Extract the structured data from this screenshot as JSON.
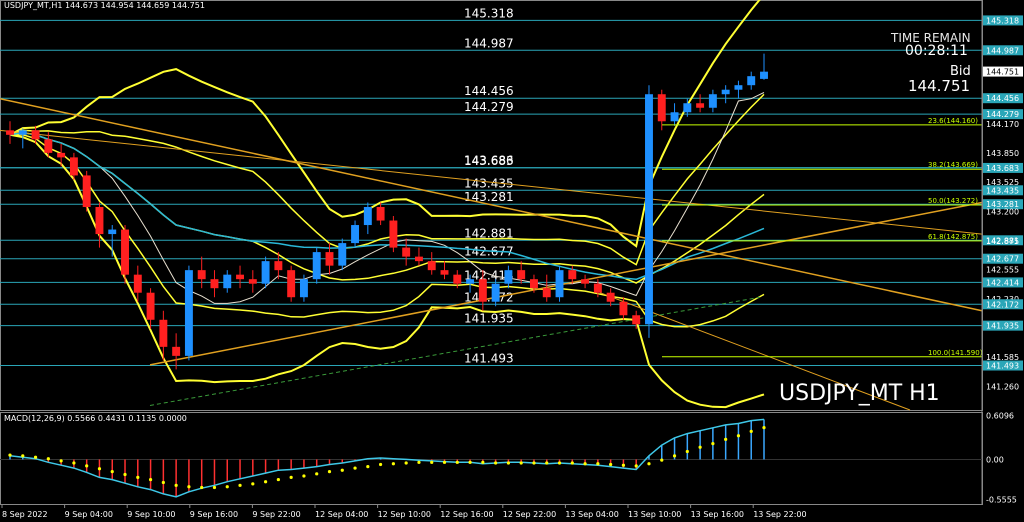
{
  "header": {
    "symbol_info": "USDJPY_MT,H1  144.673 144.954 144.659 144.751"
  },
  "time_remain": {
    "label": "TIME REMAIN",
    "value": "00:28:11"
  },
  "bid": {
    "label": "Bid",
    "value": "144.751"
  },
  "watermark": "USDJPY_MT H1",
  "macd_header": "MACD(12,26,9) 0.5566 0.4431 0.1135 0.0000",
  "colors": {
    "background": "#000000",
    "bull_candle": "#1e90ff",
    "bear_candle": "#ff2020",
    "bollinger": "#ffff33",
    "trendline": "#e0a020",
    "fib": "#c8ff00",
    "ma_cyan": "#2ab8d8",
    "level_line": "#2aa6b8",
    "macd_signal": "#ffff00"
  },
  "chart_data": [
    {
      "type": "candlestick",
      "title": "USDJPY_MT H1",
      "ylim": [
        141.0,
        145.5
      ],
      "y_axis_ticks": [
        "145.318",
        "144.987",
        "144.751",
        "144.456",
        "144.279",
        "144.170",
        "143.850",
        "143.683",
        "143.525",
        "143.435",
        "143.281",
        "143.200",
        "142.881",
        "142.875",
        "142.677",
        "142.555",
        "142.414",
        "142.230",
        "142.172",
        "141.935",
        "141.585",
        "141.493",
        "141.260"
      ],
      "x_tick_labels": [
        "8 Sep 2022",
        "9 Sep 04:00",
        "9 Sep 10:00",
        "9 Sep 16:00",
        "9 Sep 22:00",
        "12 Sep 04:00",
        "12 Sep 10:00",
        "12 Sep 16:00",
        "12 Sep 22:00",
        "13 Sep 04:00",
        "13 Sep 10:00",
        "13 Sep 16:00",
        "13 Sep 22:00"
      ],
      "horizontal_levels": [
        {
          "value": 145.318,
          "label": "145.318"
        },
        {
          "value": 144.987,
          "label": "144.987"
        },
        {
          "value": 144.456,
          "label": "144.456"
        },
        {
          "value": 144.279,
          "label": "144.279"
        },
        {
          "value": 143.686,
          "label": "143.686"
        },
        {
          "value": 143.683,
          "label": "143.683"
        },
        {
          "value": 143.435,
          "label": "143.435"
        },
        {
          "value": 143.281,
          "label": "143.281"
        },
        {
          "value": 142.881,
          "label": "142.881"
        },
        {
          "value": 142.677,
          "label": "142.677"
        },
        {
          "value": 142.414,
          "label": "142.414"
        },
        {
          "value": 142.172,
          "label": "142.172"
        },
        {
          "value": 141.935,
          "label": "141.935"
        },
        {
          "value": 141.493,
          "label": "141.493"
        }
      ],
      "fibonacci": [
        {
          "label": "23.6(144.160)",
          "value": 144.16
        },
        {
          "label": "38.2(143.669)",
          "value": 143.669
        },
        {
          "label": "50.0(143.272)",
          "value": 143.272
        },
        {
          "label": "61.8(142.875)",
          "value": 142.875
        },
        {
          "label": "100.0(141.590)",
          "value": 141.59
        }
      ],
      "candles": [
        {
          "o": 144.1,
          "h": 144.2,
          "l": 143.95,
          "c": 144.05
        },
        {
          "o": 144.05,
          "h": 144.12,
          "l": 143.9,
          "c": 144.1
        },
        {
          "o": 144.1,
          "h": 144.15,
          "l": 143.95,
          "c": 144.0
        },
        {
          "o": 144.0,
          "h": 144.08,
          "l": 143.8,
          "c": 143.85
        },
        {
          "o": 143.85,
          "h": 143.95,
          "l": 143.7,
          "c": 143.8
        },
        {
          "o": 143.8,
          "h": 143.85,
          "l": 143.55,
          "c": 143.6
        },
        {
          "o": 143.6,
          "h": 143.65,
          "l": 143.2,
          "c": 143.25
        },
        {
          "o": 143.25,
          "h": 143.3,
          "l": 142.8,
          "c": 142.95
        },
        {
          "o": 142.95,
          "h": 143.05,
          "l": 142.7,
          "c": 143.0
        },
        {
          "o": 143.0,
          "h": 143.05,
          "l": 142.4,
          "c": 142.5
        },
        {
          "o": 142.5,
          "h": 142.6,
          "l": 142.2,
          "c": 142.3
        },
        {
          "o": 142.3,
          "h": 142.35,
          "l": 141.9,
          "c": 142.0
        },
        {
          "o": 142.0,
          "h": 142.1,
          "l": 141.55,
          "c": 141.7
        },
        {
          "o": 141.7,
          "h": 141.85,
          "l": 141.45,
          "c": 141.6
        },
        {
          "o": 141.6,
          "h": 142.6,
          "l": 141.55,
          "c": 142.55
        },
        {
          "o": 142.55,
          "h": 142.7,
          "l": 142.35,
          "c": 142.45
        },
        {
          "o": 142.45,
          "h": 142.55,
          "l": 142.25,
          "c": 142.35
        },
        {
          "o": 142.35,
          "h": 142.55,
          "l": 142.3,
          "c": 142.5
        },
        {
          "o": 142.5,
          "h": 142.6,
          "l": 142.35,
          "c": 142.45
        },
        {
          "o": 142.45,
          "h": 142.55,
          "l": 142.3,
          "c": 142.4
        },
        {
          "o": 142.4,
          "h": 142.7,
          "l": 142.35,
          "c": 142.65
        },
        {
          "o": 142.65,
          "h": 142.75,
          "l": 142.45,
          "c": 142.55
        },
        {
          "o": 142.55,
          "h": 142.6,
          "l": 142.2,
          "c": 142.25
        },
        {
          "o": 142.25,
          "h": 142.5,
          "l": 142.2,
          "c": 142.45
        },
        {
          "o": 142.45,
          "h": 142.8,
          "l": 142.4,
          "c": 142.75
        },
        {
          "o": 142.75,
          "h": 142.85,
          "l": 142.5,
          "c": 142.6
        },
        {
          "o": 142.6,
          "h": 142.9,
          "l": 142.55,
          "c": 142.85
        },
        {
          "o": 142.85,
          "h": 143.1,
          "l": 142.8,
          "c": 143.05
        },
        {
          "o": 143.05,
          "h": 143.3,
          "l": 142.95,
          "c": 143.25
        },
        {
          "o": 143.25,
          "h": 143.3,
          "l": 143.05,
          "c": 143.1
        },
        {
          "o": 143.1,
          "h": 143.15,
          "l": 142.75,
          "c": 142.8
        },
        {
          "o": 142.8,
          "h": 142.9,
          "l": 142.6,
          "c": 142.7
        },
        {
          "o": 142.7,
          "h": 142.8,
          "l": 142.6,
          "c": 142.65
        },
        {
          "o": 142.65,
          "h": 142.75,
          "l": 142.5,
          "c": 142.55
        },
        {
          "o": 142.55,
          "h": 142.65,
          "l": 142.45,
          "c": 142.5
        },
        {
          "o": 142.5,
          "h": 142.55,
          "l": 142.35,
          "c": 142.4
        },
        {
          "o": 142.4,
          "h": 142.5,
          "l": 142.3,
          "c": 142.45
        },
        {
          "o": 142.45,
          "h": 142.55,
          "l": 142.1,
          "c": 142.2
        },
        {
          "o": 142.2,
          "h": 142.45,
          "l": 142.15,
          "c": 142.4
        },
        {
          "o": 142.4,
          "h": 142.6,
          "l": 142.35,
          "c": 142.55
        },
        {
          "o": 142.55,
          "h": 142.65,
          "l": 142.4,
          "c": 142.45
        },
        {
          "o": 142.45,
          "h": 142.5,
          "l": 142.3,
          "c": 142.35
        },
        {
          "o": 142.35,
          "h": 142.5,
          "l": 142.2,
          "c": 142.25
        },
        {
          "o": 142.25,
          "h": 142.6,
          "l": 142.2,
          "c": 142.55
        },
        {
          "o": 142.55,
          "h": 142.6,
          "l": 142.4,
          "c": 142.45
        },
        {
          "o": 142.45,
          "h": 142.5,
          "l": 142.35,
          "c": 142.4
        },
        {
          "o": 142.4,
          "h": 142.45,
          "l": 142.25,
          "c": 142.3
        },
        {
          "o": 142.3,
          "h": 142.35,
          "l": 142.15,
          "c": 142.2
        },
        {
          "o": 142.2,
          "h": 142.25,
          "l": 142.0,
          "c": 142.05
        },
        {
          "o": 142.05,
          "h": 142.1,
          "l": 141.9,
          "c": 141.95
        },
        {
          "o": 141.95,
          "h": 144.6,
          "l": 141.8,
          "c": 144.5
        },
        {
          "o": 144.5,
          "h": 144.55,
          "l": 144.1,
          "c": 144.2
        },
        {
          "o": 144.2,
          "h": 144.4,
          "l": 144.15,
          "c": 144.3
        },
        {
          "o": 144.3,
          "h": 144.45,
          "l": 144.25,
          "c": 144.4
        },
        {
          "o": 144.4,
          "h": 144.5,
          "l": 144.3,
          "c": 144.35
        },
        {
          "o": 144.35,
          "h": 144.55,
          "l": 144.3,
          "c": 144.5
        },
        {
          "o": 144.5,
          "h": 144.6,
          "l": 144.4,
          "c": 144.55
        },
        {
          "o": 144.55,
          "h": 144.65,
          "l": 144.45,
          "c": 144.6
        },
        {
          "o": 144.6,
          "h": 144.75,
          "l": 144.55,
          "c": 144.7
        },
        {
          "o": 144.67,
          "h": 144.95,
          "l": 144.66,
          "c": 144.75
        }
      ]
    },
    {
      "type": "bar",
      "title": "MACD(12,26,9)",
      "ylim": [
        -0.62,
        0.66
      ],
      "y_axis_ticks": [
        "0.6096",
        "0.00",
        "-0.5555"
      ],
      "values": [
        0.05,
        0.03,
        0.01,
        -0.04,
        -0.08,
        -0.12,
        -0.18,
        -0.25,
        -0.28,
        -0.33,
        -0.38,
        -0.42,
        -0.48,
        -0.52,
        -0.45,
        -0.4,
        -0.36,
        -0.31,
        -0.27,
        -0.23,
        -0.19,
        -0.15,
        -0.14,
        -0.12,
        -0.1,
        -0.07,
        -0.05,
        -0.02,
        0.01,
        0.02,
        0.01,
        0.0,
        -0.01,
        -0.02,
        -0.03,
        -0.04,
        -0.04,
        -0.06,
        -0.05,
        -0.04,
        -0.04,
        -0.05,
        -0.06,
        -0.05,
        -0.06,
        -0.07,
        -0.08,
        -0.1,
        -0.12,
        -0.14,
        0.05,
        0.2,
        0.3,
        0.36,
        0.4,
        0.44,
        0.48,
        0.5,
        0.54,
        0.5566
      ],
      "signal": [
        0.06,
        0.05,
        0.03,
        0.01,
        -0.02,
        -0.05,
        -0.09,
        -0.13,
        -0.17,
        -0.21,
        -0.25,
        -0.28,
        -0.32,
        -0.36,
        -0.38,
        -0.39,
        -0.39,
        -0.38,
        -0.36,
        -0.34,
        -0.31,
        -0.28,
        -0.25,
        -0.23,
        -0.2,
        -0.17,
        -0.15,
        -0.12,
        -0.1,
        -0.07,
        -0.06,
        -0.05,
        -0.04,
        -0.04,
        -0.04,
        -0.04,
        -0.04,
        -0.04,
        -0.05,
        -0.05,
        -0.05,
        -0.05,
        -0.05,
        -0.05,
        -0.05,
        -0.06,
        -0.06,
        -0.07,
        -0.08,
        -0.09,
        -0.06,
        -0.01,
        0.05,
        0.11,
        0.17,
        0.22,
        0.28,
        0.33,
        0.39,
        0.4431
      ]
    }
  ]
}
